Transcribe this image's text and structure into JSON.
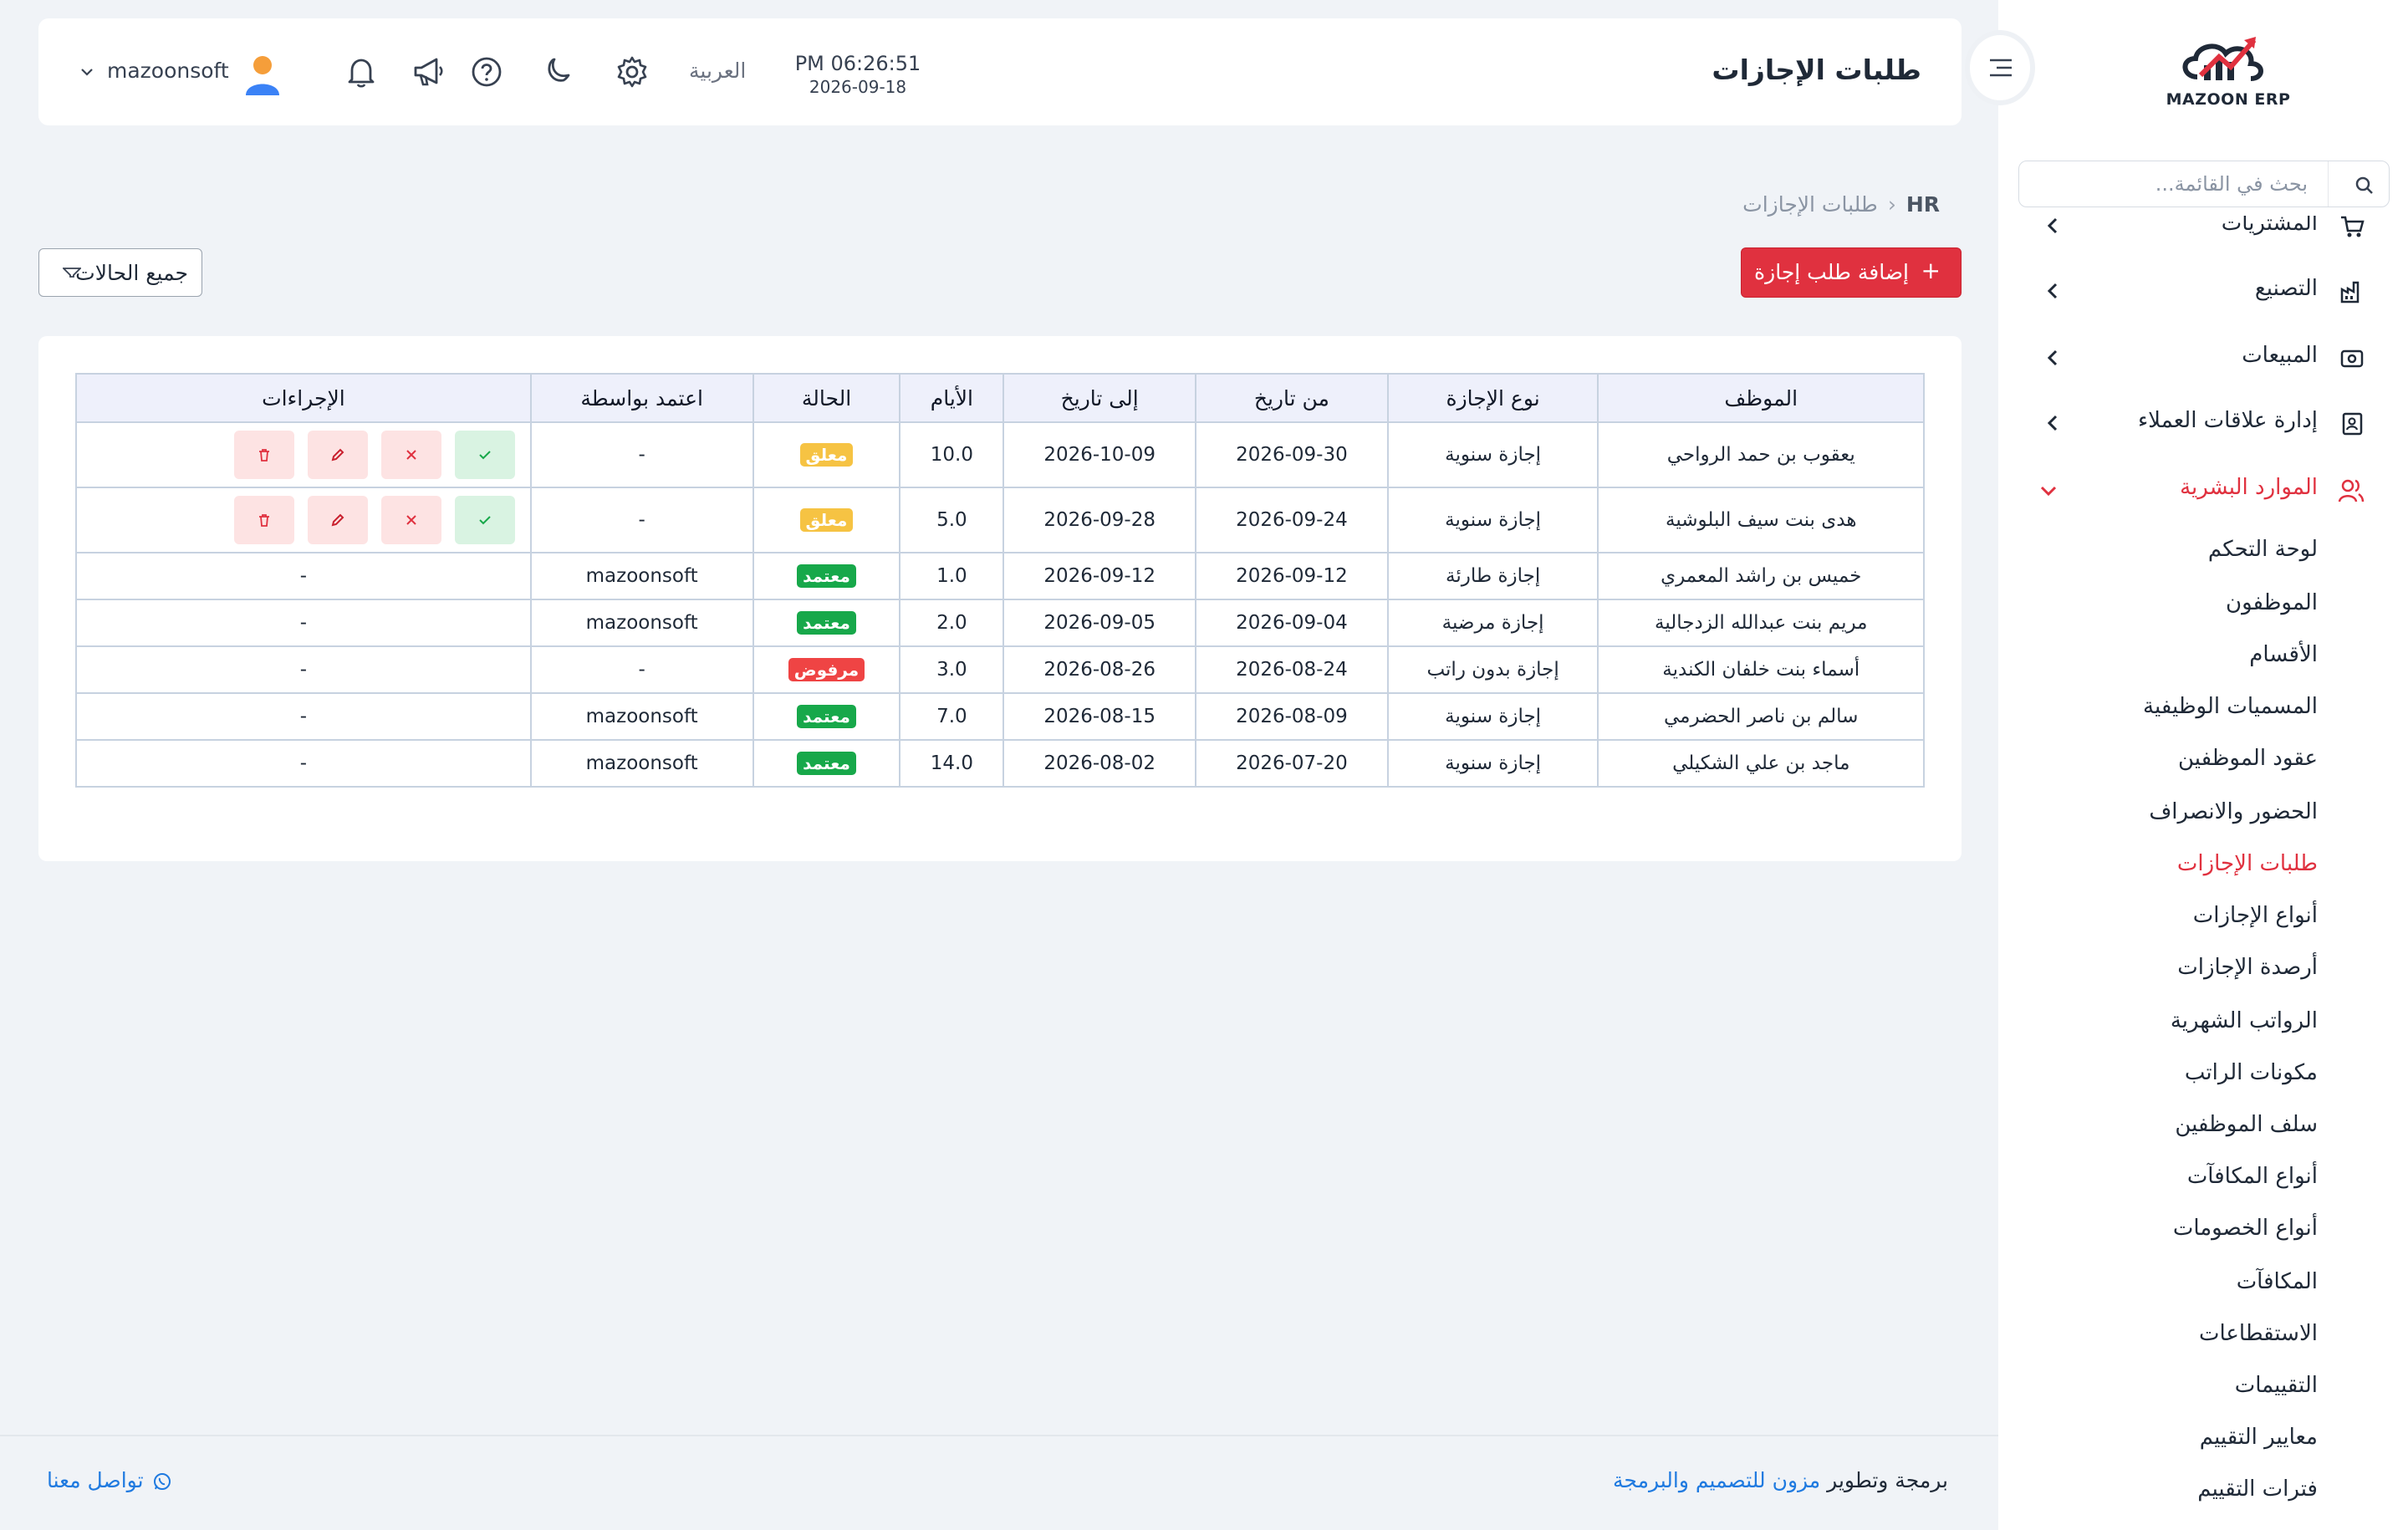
{
  "sidebar": {
    "logo_text": "MAZOON ERP",
    "search_placeholder": "بحث في القائمة...",
    "menu": [
      {
        "label": "المشتريات",
        "icon": "cart-icon"
      },
      {
        "label": "التصنيع",
        "icon": "factory-icon"
      },
      {
        "label": "المبيعات",
        "icon": "sales-icon"
      },
      {
        "label": "إدارة علاقات العملاء",
        "icon": "crm-icon"
      },
      {
        "label": "الموارد البشرية",
        "icon": "users-icon"
      }
    ],
    "hr_items": [
      "لوحة التحكم",
      "الموظفون",
      "الأقسام",
      "المسميات الوظيفية",
      "عقود الموظفين",
      "الحضور والانصراف",
      "طلبات الإجازات",
      "أنواع الإجازات",
      "أرصدة الإجازات",
      "الرواتب الشهرية",
      "مكونات الراتب",
      "سلف الموظفين",
      "أنواع المكافآت",
      "أنواع الخصومات",
      "المكافآت",
      "الاستقطاعات",
      "التقييمات",
      "معايير التقييم",
      "فترات التقييم"
    ],
    "active_item": "طلبات الإجازات"
  },
  "header": {
    "title": "طلبات الإجازات",
    "time": "PM 06:26:51",
    "date": "2026-09-18",
    "language": "العربية",
    "username": "mazoonsoft"
  },
  "breadcrumb": {
    "root": "HR",
    "current": "طلبات الإجازات"
  },
  "toolbar": {
    "add_label": "إضافة طلب إجازة",
    "filter_label": "جميع الحالات"
  },
  "table": {
    "columns": [
      "الموظف",
      "نوع الإجازة",
      "من تاريخ",
      "إلى تاريخ",
      "الأيام",
      "الحالة",
      "اعتمد بواسطة",
      "الإجراءات"
    ],
    "rows": [
      {
        "employee": "يعقوب بن حمد الرواحي",
        "type": "إجازة سنوية",
        "from": "2026-09-30",
        "to": "2026-10-09",
        "days": "10.0",
        "status": "معلق",
        "approved_by": "-",
        "actions": "-"
      },
      {
        "employee": "هدى بنت سيف البلوشية",
        "type": "إجازة سنوية",
        "from": "2026-09-24",
        "to": "2026-09-28",
        "days": "5.0",
        "status": "معلق",
        "approved_by": "-",
        "actions": "-"
      },
      {
        "employee": "خميس بن راشد المعمري",
        "type": "إجازة طارئة",
        "from": "2026-09-12",
        "to": "2026-09-12",
        "days": "1.0",
        "status": "معتمد",
        "approved_by": "mazoonsoft",
        "actions": "-"
      },
      {
        "employee": "مريم بنت عبدالله الزدجالية",
        "type": "إجازة مرضية",
        "from": "2026-09-04",
        "to": "2026-09-05",
        "days": "2.0",
        "status": "معتمد",
        "approved_by": "mazoonsoft",
        "actions": "-"
      },
      {
        "employee": "أسماء بنت خلفان الكندية",
        "type": "إجازة بدون راتب",
        "from": "2026-08-24",
        "to": "2026-08-26",
        "days": "3.0",
        "status": "مرفوض",
        "approved_by": "-",
        "actions": "-"
      },
      {
        "employee": "سالم بن ناصر الحضرمي",
        "type": "إجازة سنوية",
        "from": "2026-08-09",
        "to": "2026-08-15",
        "days": "7.0",
        "status": "معتمد",
        "approved_by": "mazoonsoft",
        "actions": "-"
      },
      {
        "employee": "ماجد بن علي الشكيلي",
        "type": "إجازة سنوية",
        "from": "2026-07-20",
        "to": "2026-08-02",
        "days": "14.0",
        "status": "معتمد",
        "approved_by": "mazoonsoft",
        "actions": "-"
      }
    ]
  },
  "footer": {
    "credit_prefix": "برمجة وتطوير",
    "credit_link": "مزون للتصميم والبرمجة",
    "contact": "تواصل معنا"
  },
  "colors": {
    "accent": "#e0313f",
    "approved": "#17a84a",
    "pending": "#f6c343",
    "rejected": "#ef4444",
    "link": "#1f7ae0"
  }
}
